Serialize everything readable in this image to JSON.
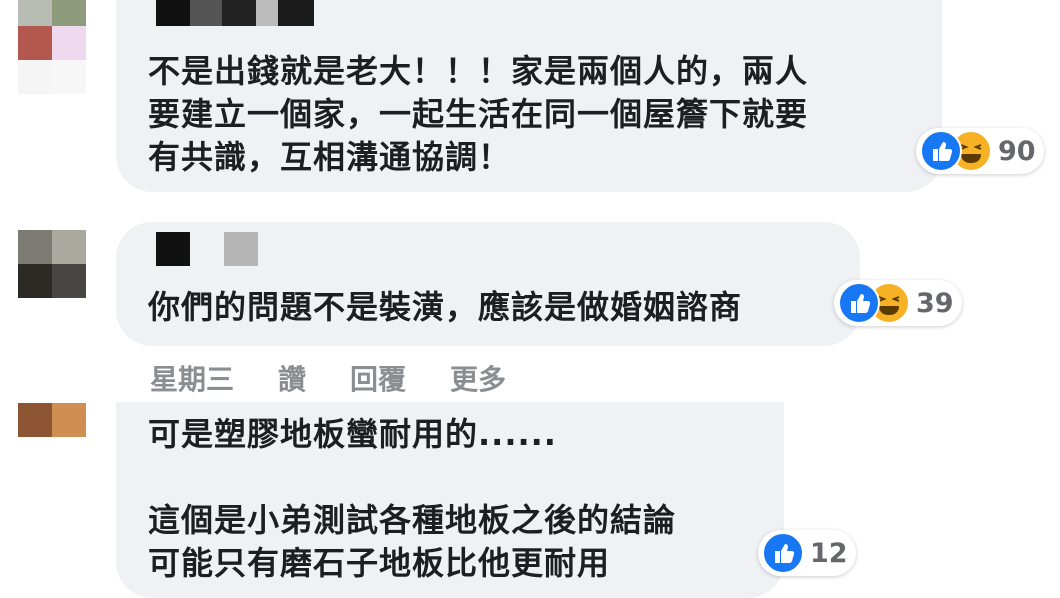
{
  "comments": [
    {
      "text": "不是出錢就是老大！！！家是兩個人的，兩人\n要建立一個家，一起生活在同一個屋簷下就要\n有共識，互相溝通協調！",
      "reaction_count": "90"
    },
    {
      "text": "你們的問題不是裝潢，應該是做婚姻諮商",
      "reaction_count": "39",
      "actions": {
        "time": "星期三",
        "like": "讚",
        "reply": "回覆",
        "more": "更多"
      }
    },
    {
      "text": "可是塑膠地板蠻耐用的......\n\n這個是小弟測試各種地板之後的結論\n可能只有磨石子地板比他更耐用",
      "reaction_count": "12"
    }
  ],
  "colors": {
    "bubble": "#eff1f4",
    "like": "#1877f2",
    "haha": "#f7b125",
    "meta_text": "#8a8d91"
  }
}
